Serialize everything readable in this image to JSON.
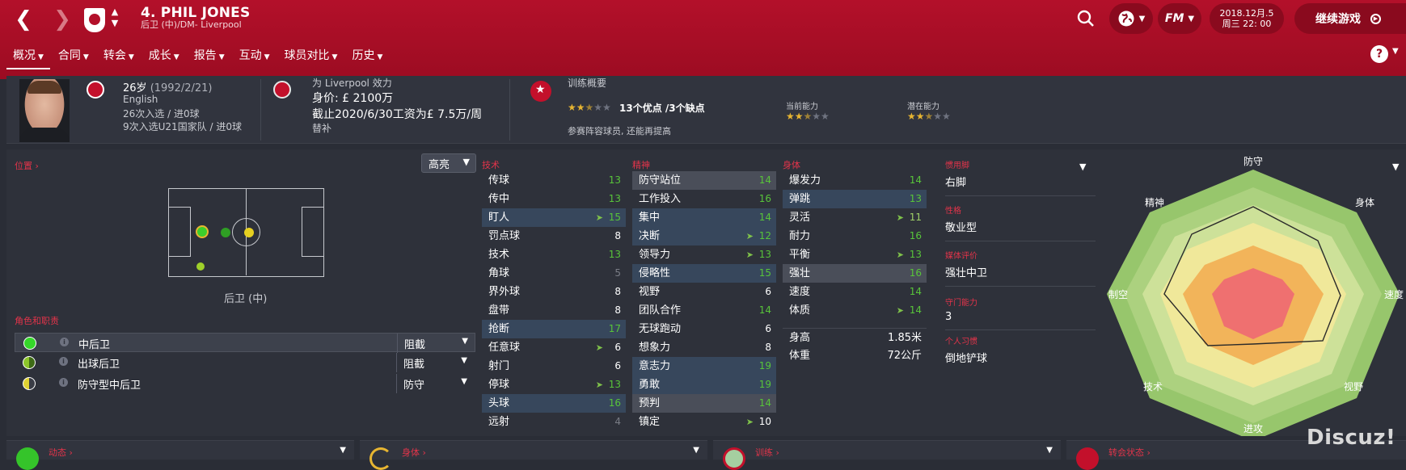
{
  "topbar": {
    "back": "❮",
    "forward": "❯",
    "player_title": "4. PHIL JONES",
    "player_position": "后卫 (中)/DM- Liverpool",
    "date_line1": "2018.12月.5",
    "date_line2": "周三 22: 00",
    "continue_label": "继续游戏",
    "fm_label": "FM"
  },
  "menu": [
    {
      "label": "概况",
      "active": true
    },
    {
      "label": "合同"
    },
    {
      "label": "转会"
    },
    {
      "label": "成长"
    },
    {
      "label": "报告"
    },
    {
      "label": "互动"
    },
    {
      "label": "球员对比"
    },
    {
      "label": "历史"
    }
  ],
  "header": {
    "age": "26岁",
    "dob": "(1992/2/21)",
    "nationality": "English",
    "caps": "26次入选 / 进0球",
    "u21_caps": "9次入选U21国家队 / 进0球",
    "club_line": "为 Liverpool 效力",
    "value": "身价: £ 2100万",
    "contract": "截止2020/6/30工资为£ 7.5万/周",
    "squad_status": "替补",
    "training_title": "训练概要",
    "strengths": "13个优点 /3个缺点",
    "training_note": "参赛阵容球员, 还能再提高",
    "current_ability_label": "当前能力",
    "potential_ability_label": "潜在能力",
    "training_stars": 2.5,
    "current_stars": 2.5,
    "potential_stars": 2.5
  },
  "position": {
    "section_label": "位置",
    "highlight_dropdown": "高亮",
    "position_label": "后卫 (中)",
    "roles_label": "角色和职责",
    "roles": [
      {
        "name": "中后卫",
        "duty": "阻截"
      },
      {
        "name": "出球后卫",
        "duty": "阻截"
      },
      {
        "name": "防守型中后卫",
        "duty": "防守"
      }
    ]
  },
  "attributes": {
    "technical_label": "技术",
    "mental_label": "精神",
    "physical_label": "身体",
    "technical": [
      {
        "name": "传球",
        "value": "13"
      },
      {
        "name": "传中",
        "value": "13"
      },
      {
        "name": "盯人",
        "value": "15"
      },
      {
        "name": "罚点球",
        "value": "8"
      },
      {
        "name": "技术",
        "value": "13"
      },
      {
        "name": "角球",
        "value": "5"
      },
      {
        "name": "界外球",
        "value": "8"
      },
      {
        "name": "盘带",
        "value": "8"
      },
      {
        "name": "抢断",
        "value": "17"
      },
      {
        "name": "任意球",
        "value": "6"
      },
      {
        "name": "射门",
        "value": "6"
      },
      {
        "name": "停球",
        "value": "13"
      },
      {
        "name": "头球",
        "value": "16"
      },
      {
        "name": "远射",
        "value": "4"
      }
    ],
    "mental": [
      {
        "name": "防守站位",
        "value": "14"
      },
      {
        "name": "工作投入",
        "value": "16"
      },
      {
        "name": "集中",
        "value": "14"
      },
      {
        "name": "决断",
        "value": "12"
      },
      {
        "name": "领导力",
        "value": "13"
      },
      {
        "name": "侵略性",
        "value": "15"
      },
      {
        "name": "视野",
        "value": "6"
      },
      {
        "name": "团队合作",
        "value": "14"
      },
      {
        "name": "无球跑动",
        "value": "6"
      },
      {
        "name": "想象力",
        "value": "8"
      },
      {
        "name": "意志力",
        "value": "19"
      },
      {
        "name": "勇敢",
        "value": "19"
      },
      {
        "name": "预判",
        "value": "14"
      },
      {
        "name": "镇定",
        "value": "10"
      }
    ],
    "physical": [
      {
        "name": "爆发力",
        "value": "14"
      },
      {
        "name": "弹跳",
        "value": "13"
      },
      {
        "name": "灵活",
        "value": "11"
      },
      {
        "name": "耐力",
        "value": "16"
      },
      {
        "name": "平衡",
        "value": "13"
      },
      {
        "name": "强壮",
        "value": "16"
      },
      {
        "name": "速度",
        "value": "14"
      },
      {
        "name": "体质",
        "value": "14"
      }
    ],
    "height_label": "身高",
    "height_value": "1.85米",
    "weight_label": "体重",
    "weight_value": "72公斤"
  },
  "info": [
    {
      "label": "惯用脚",
      "value": "右脚"
    },
    {
      "label": "性格",
      "value": "敬业型"
    },
    {
      "label": "媒体评价",
      "value": "强壮中卫"
    },
    {
      "label": "守门能力",
      "value": "3"
    },
    {
      "label": "个人习惯",
      "value": "倒地铲球"
    }
  ],
  "radar": {
    "labels": [
      "防守",
      "身体",
      "速度",
      "视野",
      "进攻",
      "技术",
      "制空",
      "精神"
    ]
  },
  "bottom": [
    {
      "label": "动态"
    },
    {
      "label": "身体"
    },
    {
      "label": "训练"
    },
    {
      "label": "转会状态"
    }
  ],
  "watermark": "Discuz!",
  "colors": {
    "topbar": "#b3102a",
    "accent_red": "#e3344a",
    "good_green": "#58c43a",
    "star_gold": "#e7b531"
  }
}
